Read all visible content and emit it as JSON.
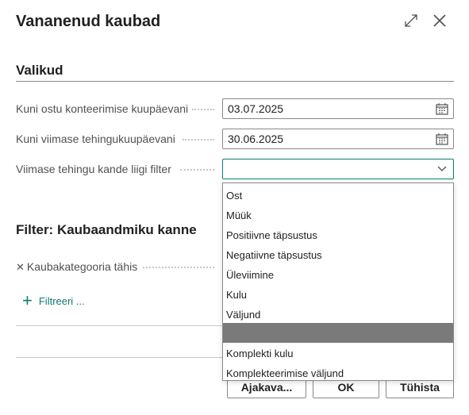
{
  "dialog": {
    "title": "Vananenud kaubad",
    "expand_icon": "expand-icon",
    "close_icon": "close-icon"
  },
  "options": {
    "section_title": "Valikud",
    "fields": [
      {
        "label": "Kuni ostu konteerimise kuupäevani",
        "value": "03.07.2025",
        "icon": "calendar-icon"
      },
      {
        "label": "Kuni viimase tehingukuupäevani",
        "value": "30.06.2025",
        "icon": "calendar-icon"
      },
      {
        "label": "Viimase tehingu kande liigi filter",
        "value": "",
        "icon": "chevron-down-icon"
      }
    ]
  },
  "filter_section": {
    "title": "Filter: Kaubaandmiku kanne",
    "filter_field": "Kaubakategooria tähis",
    "add_filter_label": "Filtreeri ..."
  },
  "dropdown": {
    "options": [
      "Ost",
      "Müük",
      "Positiivne täpsustus",
      "Negatiivne täpsustus",
      "Üleviimine",
      "Kulu",
      "Väljund",
      "",
      "Komplekti kulu",
      "Komplekteerimise väljund"
    ],
    "highlighted_index": 7
  },
  "buttons": {
    "schedule": "Ajakava...",
    "ok": "OK",
    "cancel": "Tühista"
  },
  "colors": {
    "accent": "#0d7e6e",
    "highlight": "#7a7a7a",
    "border": "#8a8a8a"
  }
}
